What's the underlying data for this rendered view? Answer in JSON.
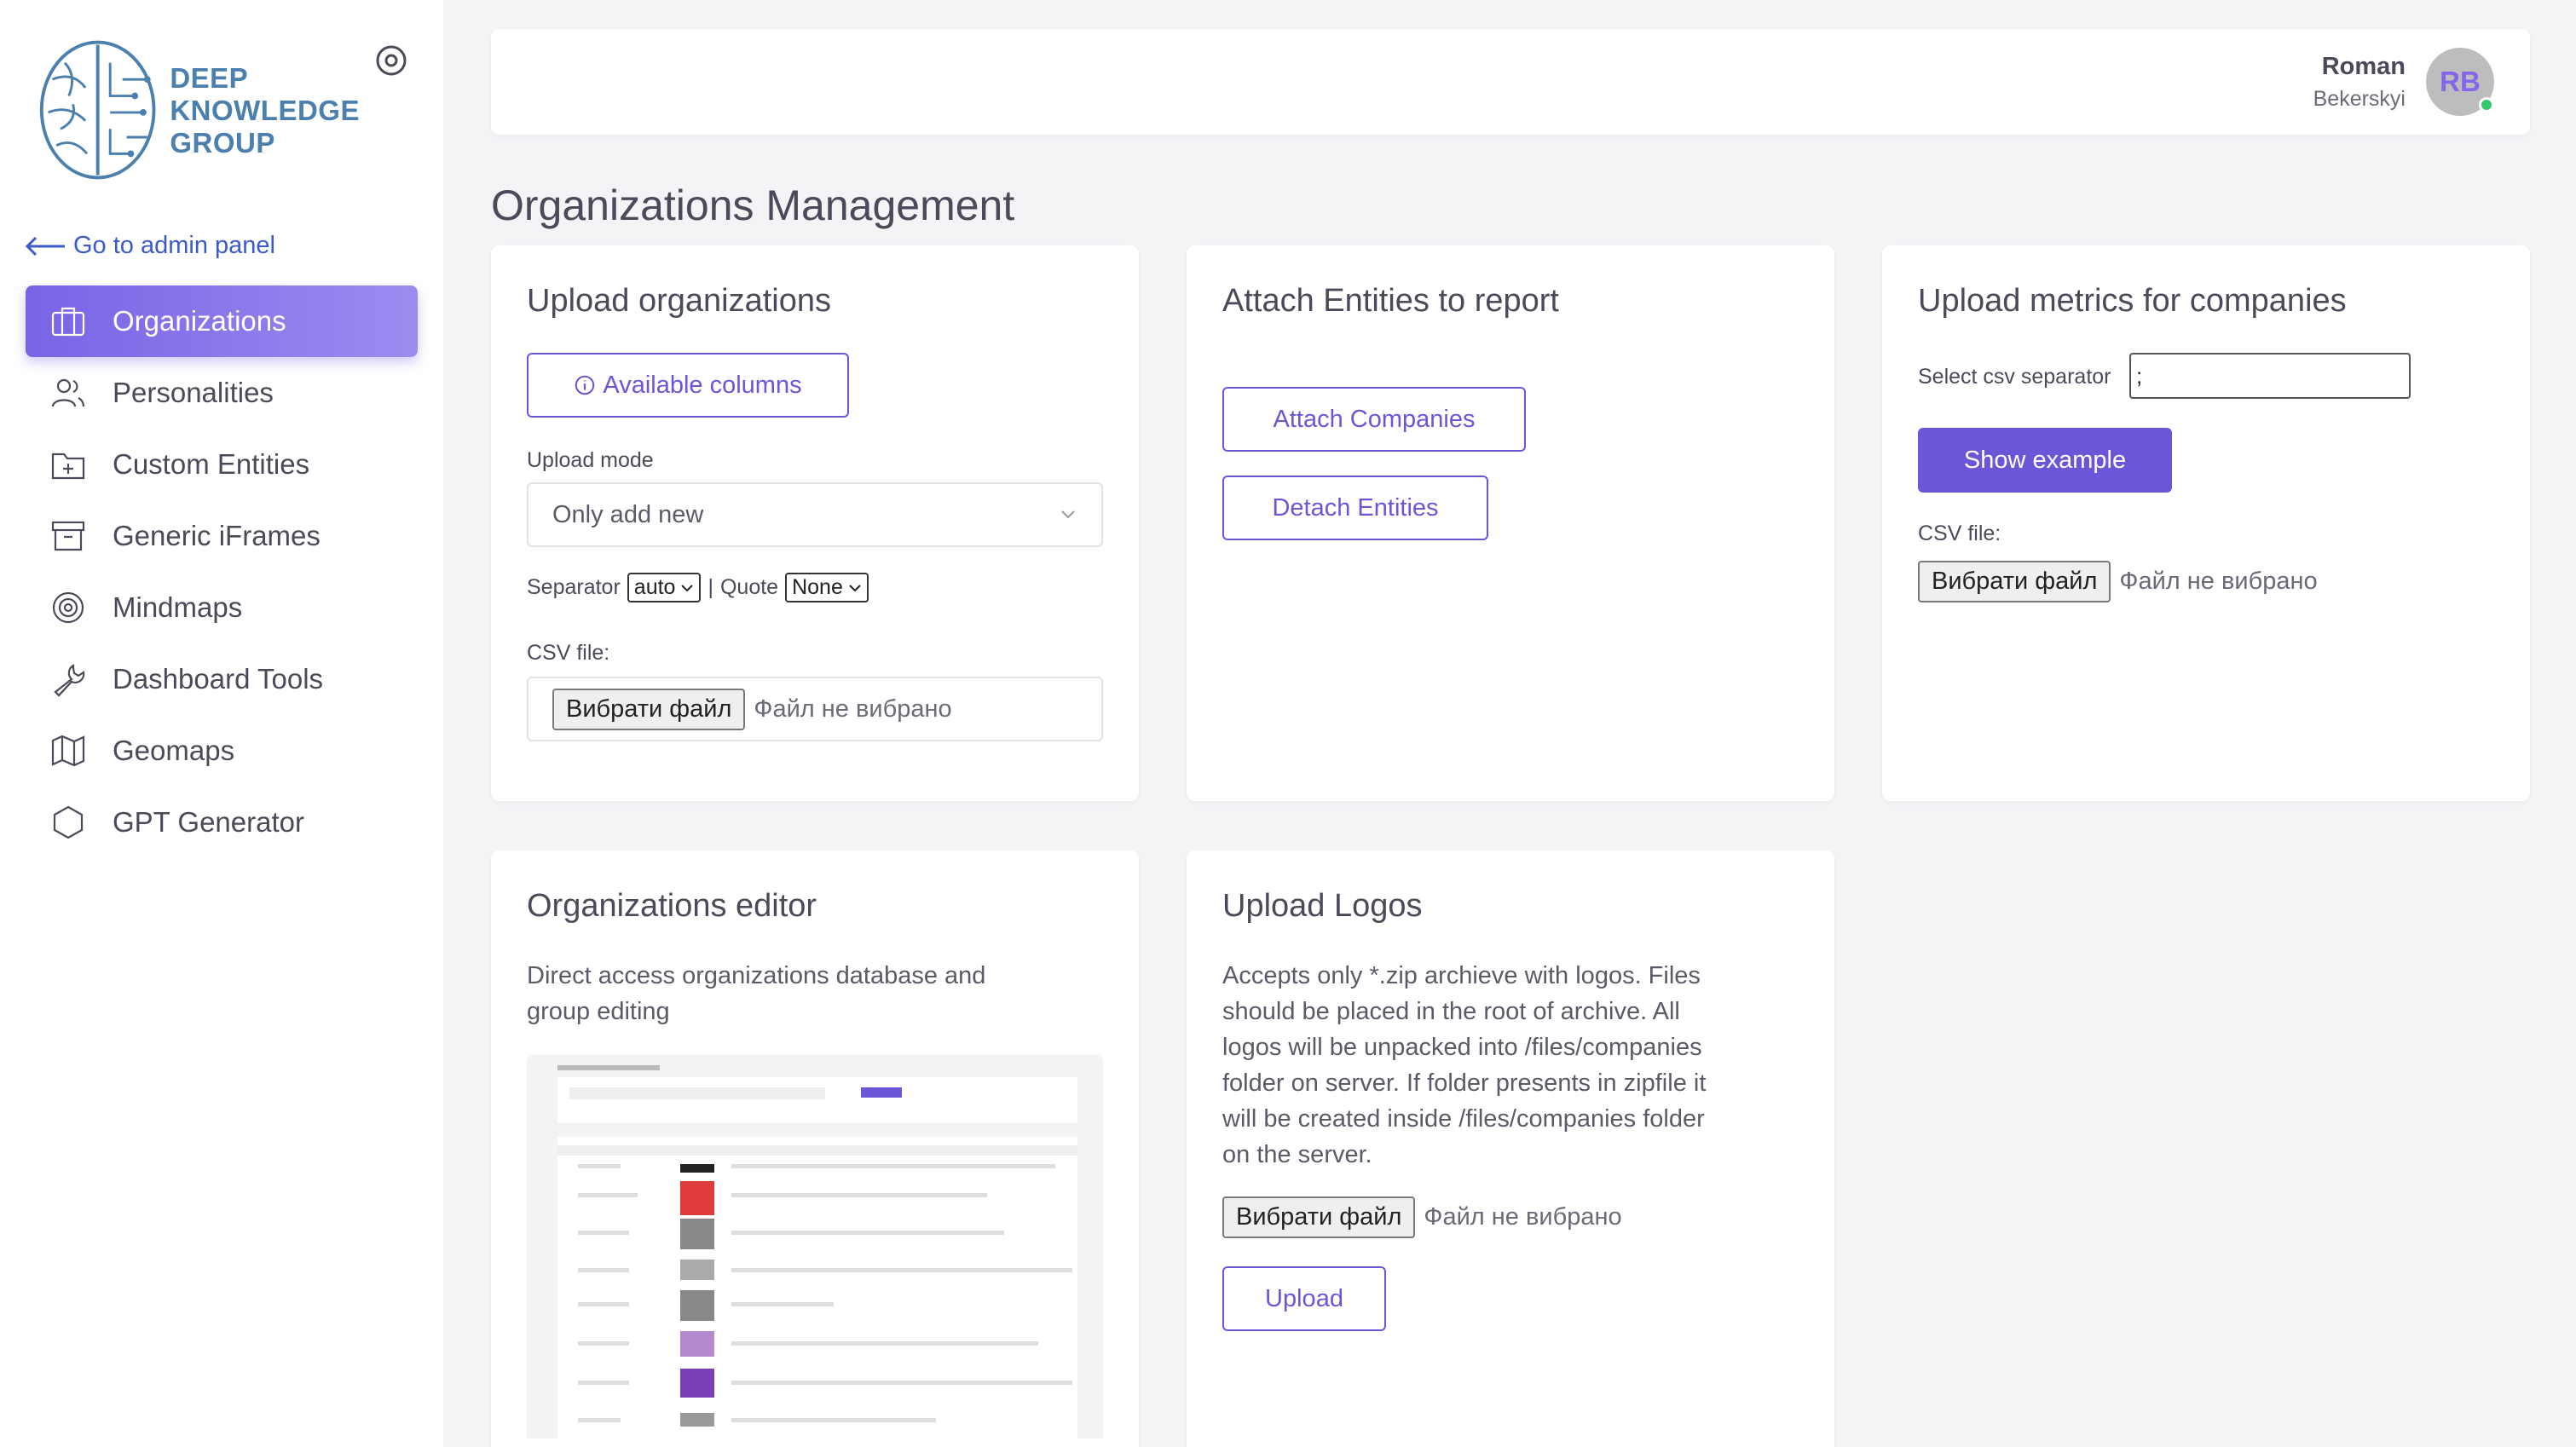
{
  "sidebar": {
    "logo_lines": [
      "DEEP",
      "KNOWLEDGE",
      "GROUP"
    ],
    "back_link": "Go to admin panel",
    "items": [
      {
        "label": "Organizations",
        "icon": "briefcase-icon",
        "active": true
      },
      {
        "label": "Personalities",
        "icon": "users-icon"
      },
      {
        "label": "Custom Entities",
        "icon": "folder-plus-icon"
      },
      {
        "label": "Generic iFrames",
        "icon": "archive-icon"
      },
      {
        "label": "Mindmaps",
        "icon": "target-icon"
      },
      {
        "label": "Dashboard Tools",
        "icon": "wrench-icon"
      },
      {
        "label": "Geomaps",
        "icon": "map-icon"
      },
      {
        "label": "GPT Generator",
        "icon": "hexagon-icon"
      }
    ]
  },
  "header": {
    "user_first": "Roman",
    "user_last": "Bekerskyi",
    "avatar_initials": "RB"
  },
  "page_title": "Organizations Management",
  "upload_orgs": {
    "title": "Upload organizations",
    "columns_button": "Available columns",
    "mode_label": "Upload mode",
    "mode_value": "Only add new",
    "separator_label": "Separator",
    "separator_value": "auto",
    "pipe": "|",
    "quote_label": "Quote",
    "quote_value": "None",
    "csv_label": "CSV file:",
    "file_button": "Вибрати файл",
    "file_status": "Файл не вибрано"
  },
  "attach": {
    "title": "Attach Entities to report",
    "attach_button": "Attach Companies",
    "detach_button": "Detach Entities"
  },
  "metrics": {
    "title": "Upload metrics for companies",
    "separator_label": "Select csv separator",
    "separator_value": ";",
    "show_example": "Show example",
    "csv_label": "CSV file:",
    "file_button": "Вибрати файл",
    "file_status": "Файл не вибрано"
  },
  "editor": {
    "title": "Organizations editor",
    "desc_line1": "Direct access organizations database and",
    "desc_line2": "group editing"
  },
  "logos": {
    "title": "Upload Logos",
    "desc_lines": [
      "Accepts only *.zip archieve with logos. Files",
      "should be placed in the root of archive. All",
      "logos will be unpacked into /files/companies",
      "folder on server. If folder presents in zipfile it",
      "will be created inside /files/companies folder",
      "on the server."
    ],
    "file_button": "Вибрати файл",
    "file_status": "Файл не вибрано",
    "upload_button": "Upload"
  },
  "colors": {
    "accent": "#6d55d8",
    "active_nav": "#7a63e6",
    "online": "#31c96a",
    "brand_logo": "#4a7fae"
  }
}
